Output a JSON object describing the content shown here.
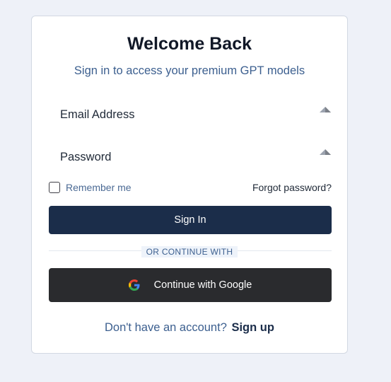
{
  "title": "Welcome Back",
  "subtitle": "Sign in to access your premium GPT models",
  "form": {
    "email_label": "Email Address",
    "password_label": "Password",
    "remember_label": "Remember me",
    "remember_checked": false,
    "forgot_label": "Forgot password?",
    "signin_label": "Sign In"
  },
  "divider_label": "OR CONTINUE WITH",
  "google_label": "Continue with Google",
  "footer": {
    "text": "Don't have an account?",
    "signup_label": "Sign up"
  },
  "icons": {
    "field_icon": "autofill-triangle-icon",
    "google": "google-g-icon"
  },
  "colors": {
    "primary": "#1b2d4a",
    "accent_text": "#3c5f8f",
    "google_button": "#2a2b2e",
    "background": "#eef1f8"
  }
}
